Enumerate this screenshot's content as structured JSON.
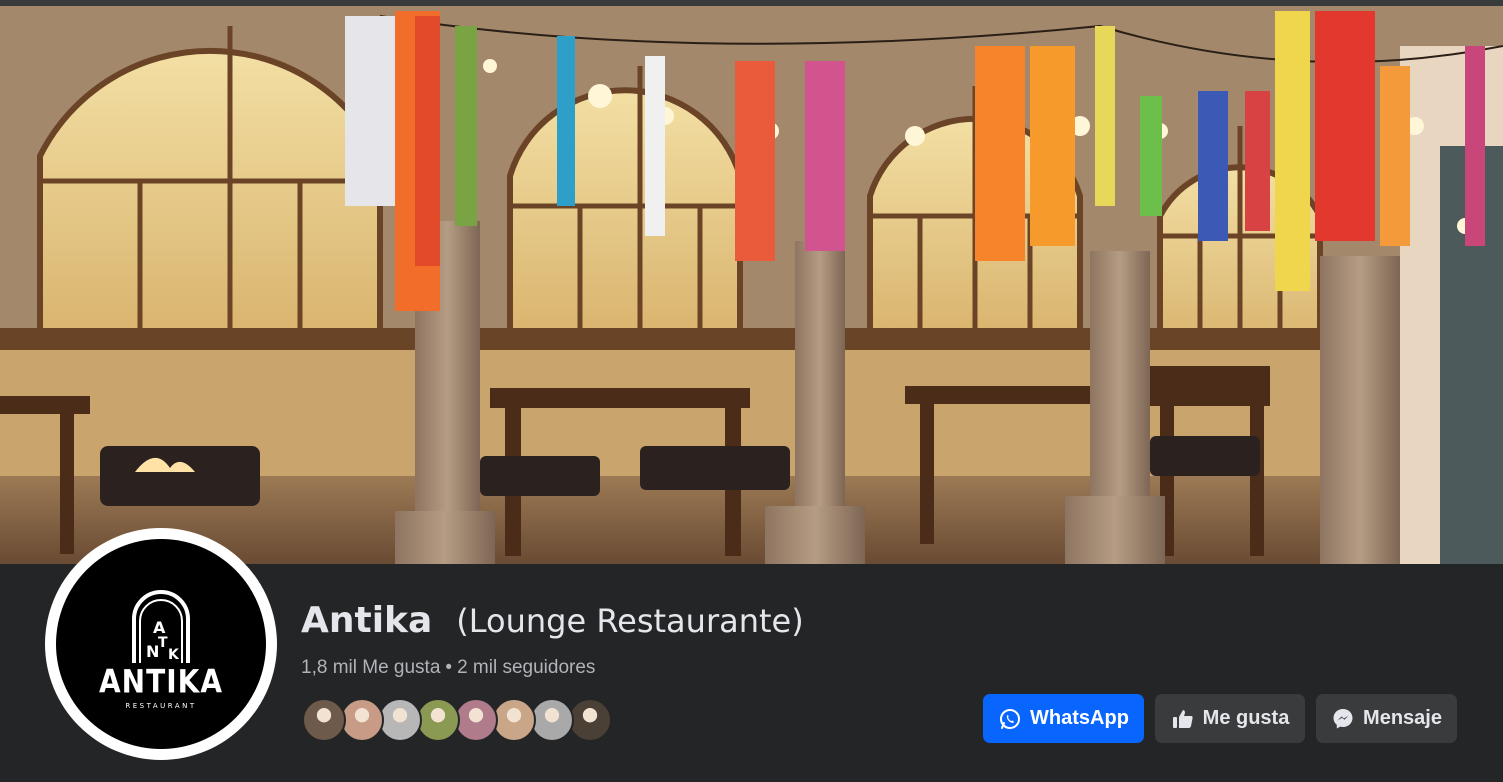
{
  "page": {
    "name": "Antika",
    "category": "(Lounge Restaurante)",
    "likes": "1,8 mil Me gusta",
    "separator": "•",
    "followers": "2 mil seguidores"
  },
  "profile": {
    "logo_name": "ANTIKA",
    "logo_sub": "RESTAURANT"
  },
  "cover": {
    "description_icon": "restaurant-terrace-photo"
  },
  "followers_preview": [
    {
      "icon": "follower-avatar",
      "color": "#6d5a4a"
    },
    {
      "icon": "follower-avatar",
      "color": "#c79b86"
    },
    {
      "icon": "follower-avatar",
      "color": "#b7b7b7"
    },
    {
      "icon": "follower-avatar",
      "color": "#8a9a52"
    },
    {
      "icon": "follower-avatar",
      "color": "#b07b8b"
    },
    {
      "icon": "follower-avatar",
      "color": "#c9a688"
    },
    {
      "icon": "follower-avatar",
      "color": "#a9a9a9"
    },
    {
      "icon": "follower-avatar",
      "color": "#4a4036"
    }
  ],
  "actions": {
    "whatsapp_label": "WhatsApp",
    "like_label": "Me gusta",
    "message_label": "Mensaje"
  },
  "colors": {
    "background": "#242526",
    "primary_button": "#0866ff",
    "secondary_button": "#3a3b3c",
    "text": "#e4e6eb",
    "muted_text": "#b0b3b8"
  }
}
